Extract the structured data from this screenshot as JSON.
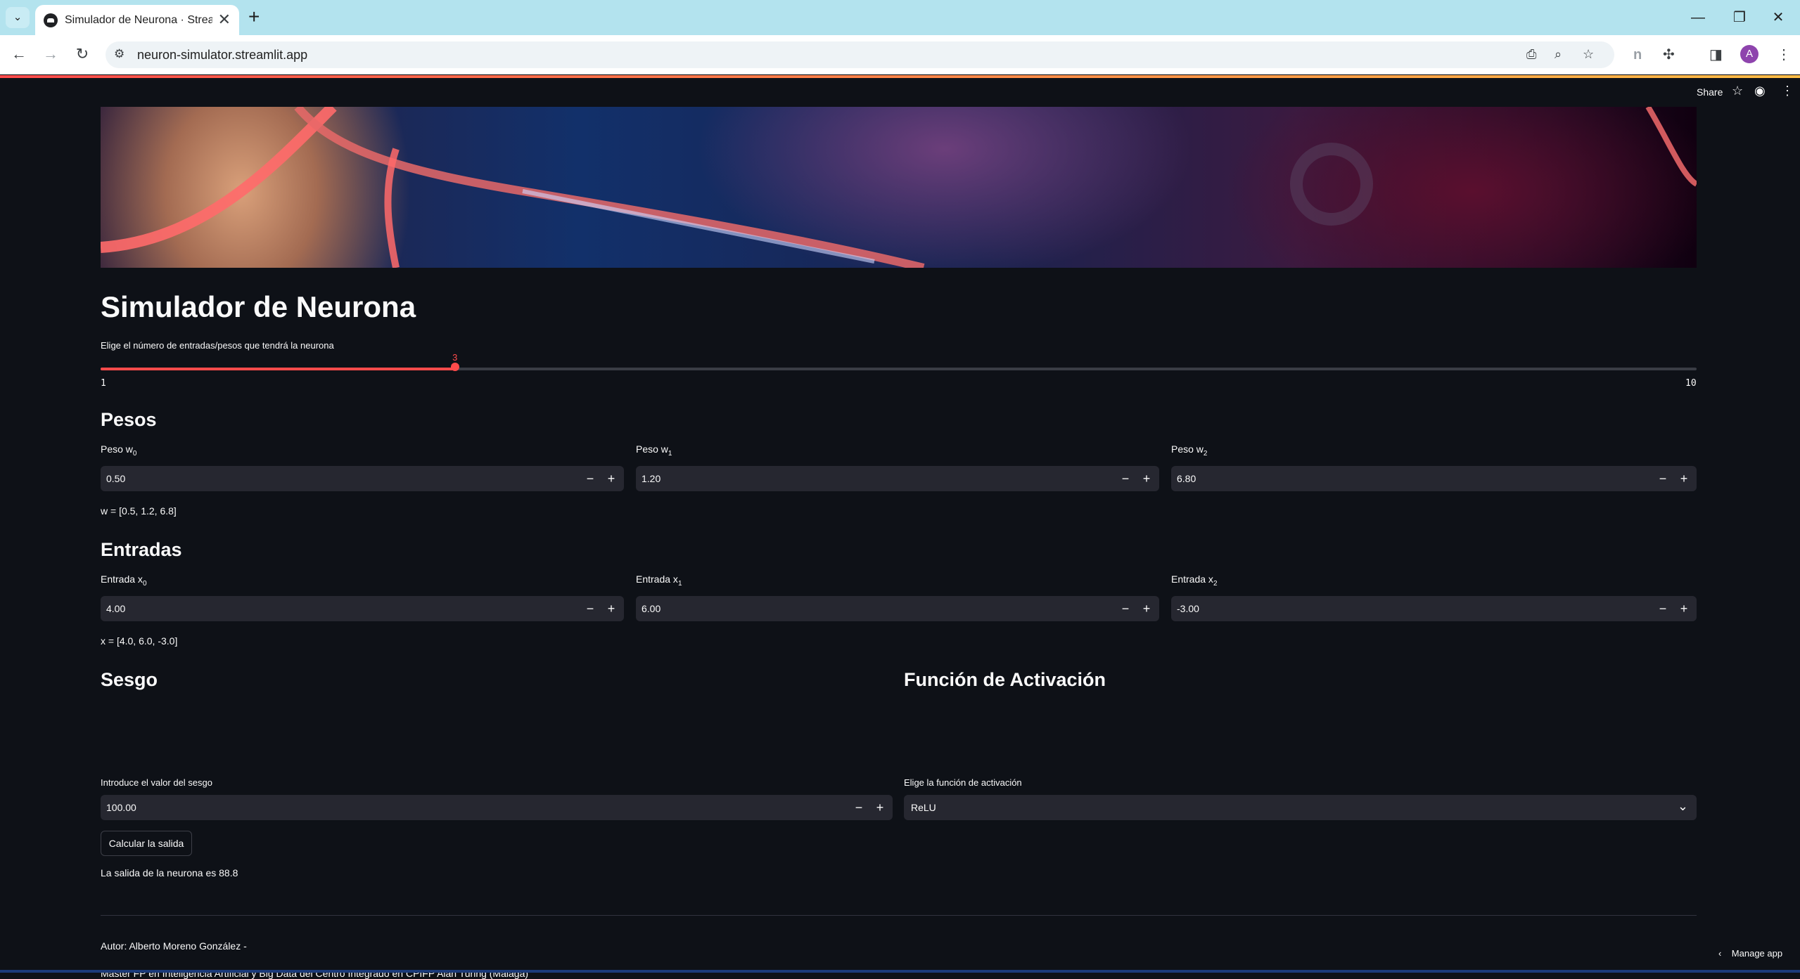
{
  "browser": {
    "tab_list_icon": "chevron-down-icon",
    "tab_title": "Simulador de Neurona · Streamlit",
    "tab_close": "✕",
    "new_tab": "+",
    "window_controls": {
      "minimize": "—",
      "restore": "❐",
      "close": "✕"
    },
    "nav": {
      "back": "←",
      "forward": "→",
      "reload": "↻"
    },
    "site_info_icon": "⚙",
    "url": "neuron-simulator.streamlit.app",
    "omnibox_icons": {
      "install": "⎙",
      "zoom": "⌕",
      "bookmark": "☆"
    },
    "toolbar_icons": {
      "extension_n": "n",
      "extensions": "✣",
      "side_panel": "◨",
      "menu": "⋮"
    },
    "profile_initial": "A",
    "profile_color": "#8e44ad"
  },
  "streamlit_header": {
    "share_label": "Share",
    "star_icon": "☆",
    "github_icon": "◉",
    "menu_icon": "⋮"
  },
  "app": {
    "title": "Simulador de Neurona",
    "slider": {
      "label": "Elige el número de entradas/pesos que tendrá la neurona",
      "value": "3",
      "min": "1",
      "max": "10",
      "fraction": 0.2222,
      "accent": "#ff4b4b"
    },
    "weights": {
      "heading": "Pesos",
      "fields": [
        {
          "label": "Peso w",
          "sub": "0",
          "value": "0.50"
        },
        {
          "label": "Peso w",
          "sub": "1",
          "value": "1.20"
        },
        {
          "label": "Peso w",
          "sub": "2",
          "value": "6.80"
        }
      ],
      "summary": "w = [0.5, 1.2, 6.8]"
    },
    "inputs": {
      "heading": "Entradas",
      "fields": [
        {
          "label": "Entrada x",
          "sub": "0",
          "value": "4.00"
        },
        {
          "label": "Entrada x",
          "sub": "1",
          "value": "6.00"
        },
        {
          "label": "Entrada x",
          "sub": "2",
          "value": "-3.00"
        }
      ],
      "summary": "x = [4.0, 6.0, -3.0]"
    },
    "bias": {
      "heading": "Sesgo",
      "label": "Introduce el valor del sesgo",
      "value": "100.00"
    },
    "activation": {
      "heading": "Función de Activación",
      "label": "Elige la función de activación",
      "value": "ReLU"
    },
    "stepper": {
      "minus": "−",
      "plus": "+"
    },
    "calculate_button": "Calcular la salida",
    "output": "La salida de la neurona es 88.8",
    "author": "Autor: Alberto Moreno González -",
    "affiliation": "Máster FP en Inteligencia Artificial y Big Data del Centro Integrado en CPIFP Alan Turing (Málaga)",
    "manage_app": "Manage app",
    "manage_icon": "‹"
  }
}
